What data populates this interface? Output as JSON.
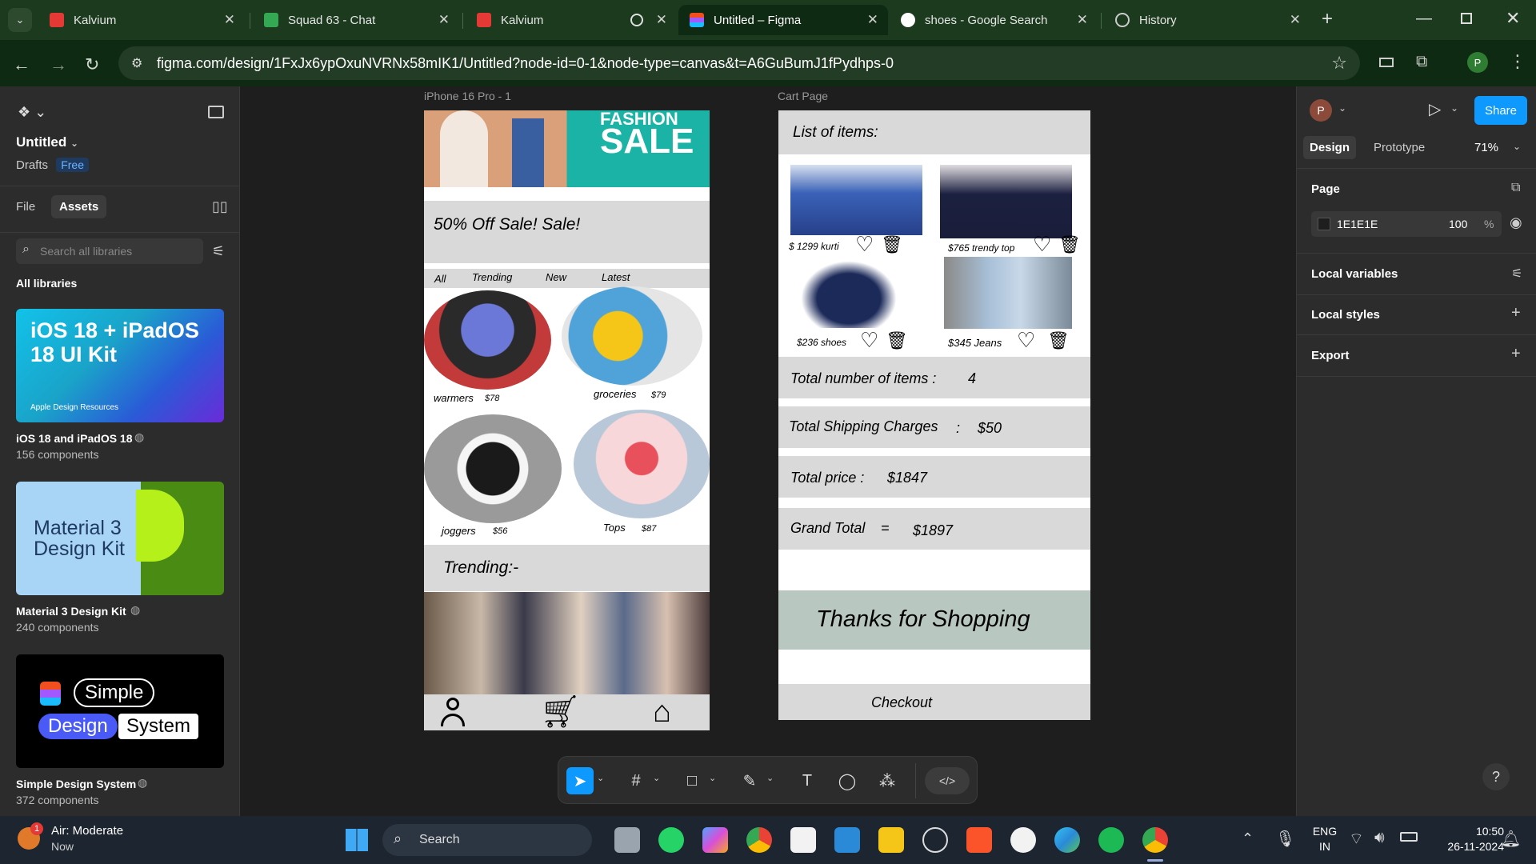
{
  "browser": {
    "tabs": [
      {
        "title": "Kalvium",
        "icon": "kalvium-icon",
        "color": "#e53935"
      },
      {
        "title": "Squad 63 - Chat",
        "icon": "chat-icon",
        "color": "#34a853"
      },
      {
        "title": "Kalvium",
        "icon": "kalvium-icon",
        "color": "#e53935"
      },
      {
        "title": "Untitled – Figma",
        "icon": "figma-icon",
        "color": "#a259ff"
      },
      {
        "title": "shoes - Google Search",
        "icon": "google-icon",
        "color": "#4285f4"
      },
      {
        "title": "History",
        "icon": "history-icon",
        "color": "#cccccc"
      }
    ],
    "url": "figma.com/design/1FxJx6ypOxuNVRNx58mIK1/Untitled?node-id=0-1&node-type=canvas&t=A6GuBumJ1fPydhps-0",
    "profile_initial": "P"
  },
  "left_panel": {
    "file_name": "Untitled",
    "location": "Drafts",
    "plan_badge": "Free",
    "tabs": [
      "File",
      "Assets"
    ],
    "search_placeholder": "Search all libraries",
    "section_title": "All libraries",
    "libraries": [
      {
        "name": "iOS 18 and iPadOS 18",
        "count": "156 components",
        "card_text": "iOS 18 + iPadOS 18 UI Kit",
        "card_sub": "Apple Design Resources"
      },
      {
        "name": "Material 3 Design Kit",
        "count": "240 components",
        "card_text": "Material 3 Design Kit"
      },
      {
        "name": "Simple Design System",
        "count": "372 components",
        "card_words": [
          "Simple",
          "Design",
          "System"
        ]
      }
    ]
  },
  "right_panel": {
    "profile_initial": "P",
    "share_label": "Share",
    "tabs": [
      "Design",
      "Prototype"
    ],
    "zoom": "71%",
    "page_section": "Page",
    "page_color": "1E1E1E",
    "page_opacity": "100",
    "percent": "%",
    "sections": [
      "Local variables",
      "Local styles",
      "Export"
    ]
  },
  "canvas": {
    "phone_label": "iPhone 16 Pro - 1",
    "cart_label": "Cart Page",
    "phone": {
      "banner_text_1": "FASHION",
      "banner_text_2": "SALE",
      "sale_text": "50% Off  Sale! Sale!",
      "categories": [
        "All",
        "Trending",
        "New",
        "Latest"
      ],
      "products": [
        {
          "name": "warmers",
          "price": "$78"
        },
        {
          "name": "groceries",
          "price": "$79"
        },
        {
          "name": "joggers",
          "price": "$56"
        },
        {
          "name": "Tops",
          "price": "$87"
        }
      ],
      "trending": "Trending:-"
    },
    "cart": {
      "header": "List of items:",
      "items": [
        {
          "label": "$ 1299 kurti"
        },
        {
          "label": "$765 trendy top"
        },
        {
          "label": "$236 shoes"
        },
        {
          "label": "$345 Jeans"
        }
      ],
      "total_items_label": "Total number of items :",
      "total_items_value": "4",
      "shipping_label": "Total Shipping Charges",
      "shipping_sep": ":",
      "shipping_value": "$50",
      "total_price_label": "Total price :",
      "total_price_value": "$1847",
      "grand_total_label": "Grand Total",
      "grand_total_sep": "=",
      "grand_total_value": "$1897",
      "thanks": "Thanks for Shopping",
      "checkout": "Checkout"
    }
  },
  "taskbar": {
    "weather_title": "Air: Moderate",
    "weather_sub": "Now",
    "weather_badge": "1",
    "search_label": "Search",
    "lang_1": "ENG",
    "lang_2": "IN",
    "time": "10:50",
    "date": "26-11-2024"
  }
}
